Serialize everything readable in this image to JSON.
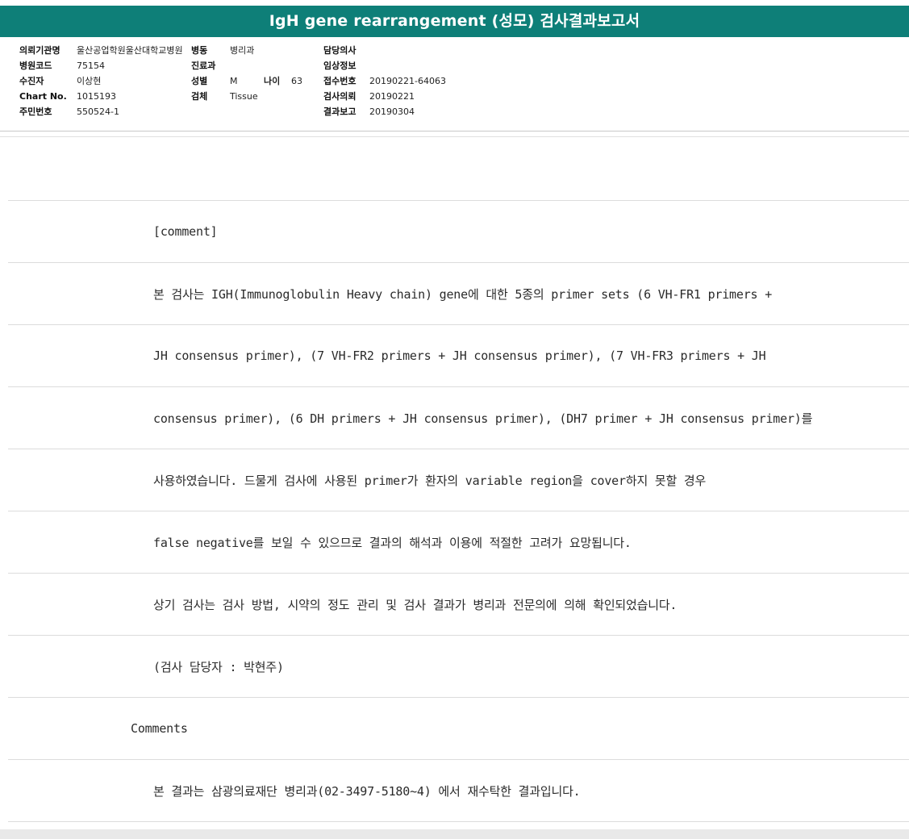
{
  "report": {
    "title": "IgH gene rearrangement (성모) 검사결과보고서"
  },
  "header": {
    "col1": [
      {
        "label": "의뢰기관명",
        "value": "울산공업학원울산대학교병원"
      },
      {
        "label": "병원코드",
        "value": "75154"
      },
      {
        "label": "수진자",
        "value": "이상현"
      },
      {
        "label": "Chart No.",
        "value": "1015193"
      },
      {
        "label": "주민번호",
        "value": "550524-1"
      }
    ],
    "col2": {
      "ward_label": "병동",
      "ward_value": "병리과",
      "dept_label": "진료과",
      "dept_value": "",
      "sex_label": "성별",
      "sex_value": "M",
      "age_label": "나이",
      "age_value": "63",
      "specimen_label": "검체",
      "specimen_value": "Tissue"
    },
    "col3": [
      {
        "label": "담당의사",
        "value": ""
      },
      {
        "label": "임상정보",
        "value": ""
      },
      {
        "label": "접수번호",
        "value": "20190221-64063"
      },
      {
        "label": "검사의뢰",
        "value": "20190221"
      },
      {
        "label": "결과보고",
        "value": "20190304"
      }
    ]
  },
  "body": {
    "lines": [
      "",
      "[comment]",
      "본 검사는 IGH(Immunoglobulin Heavy chain) gene에 대한 5종의 primer sets (6 VH-FR1 primers +",
      "JH consensus primer), (7 VH-FR2 primers + JH consensus primer), (7 VH-FR3 primers + JH",
      "consensus primer), (6 DH primers + JH consensus primer), (DH7 primer + JH consensus primer)를",
      "사용하였습니다. 드물게 검사에 사용된 primer가 환자의 variable region을 cover하지 못할 경우",
      "false negative를 보일 수 있으므로 결과의 해석과 이용에 적절한 고려가 요망됩니다.",
      "상기 검사는 검사 방법, 시약의 정도 관리 및 검사 결과가 병리과 전문의에 의해 확인되었습니다.",
      "(검사 담당자 : 박현주)"
    ],
    "section_title": "Comments",
    "section_line": "본 결과는 삼광의료재단 병리과(02-3497-5180~4) 에서 재수탁한 결과입니다."
  }
}
